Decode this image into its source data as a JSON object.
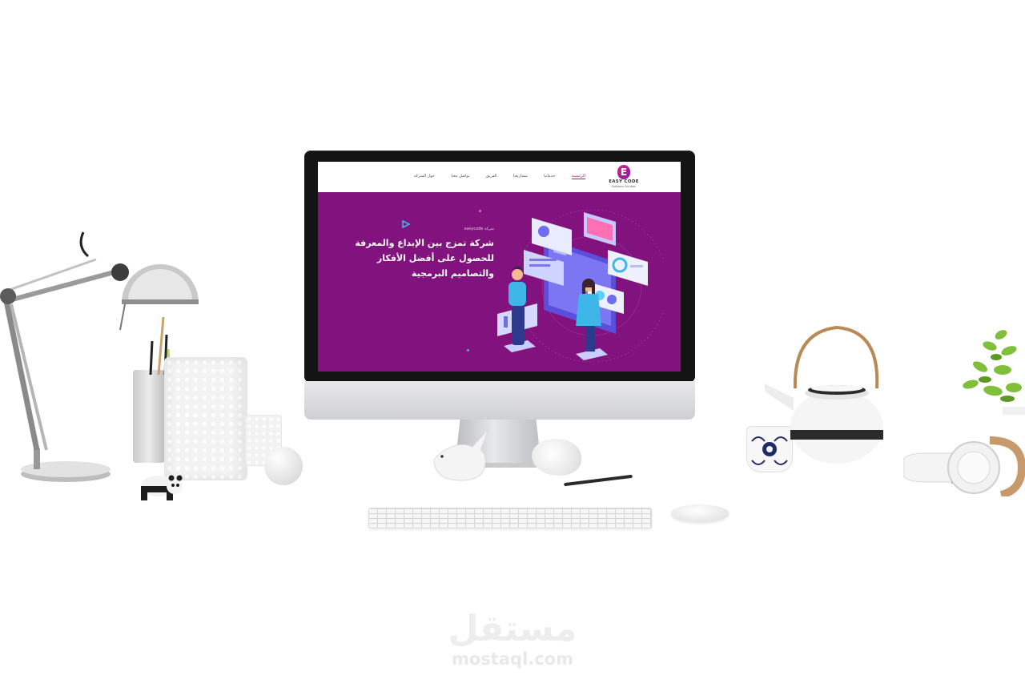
{
  "site": {
    "logo": {
      "mark": "E",
      "title": "EASY CODE",
      "subtitle": "Software Solution"
    },
    "nav": [
      {
        "label": "الرئيسية",
        "active": true
      },
      {
        "label": "خدماتنا",
        "active": false
      },
      {
        "label": "مشاريعنا",
        "active": false
      },
      {
        "label": "الفريق",
        "active": false
      },
      {
        "label": "تواصل معنا",
        "active": false
      },
      {
        "label": "حول الشركة",
        "active": false
      }
    ],
    "hero": {
      "label": "easycode شركة",
      "title_lines": [
        "شركة تمزج بين الإبداع والمعرفة",
        "للحصول على أفضل الأفكار",
        "والتصاميم البرمجية"
      ]
    },
    "colors": {
      "hero_background": "#82127d",
      "accent": "#b01e6e",
      "illustration": "#6f6cf0"
    }
  },
  "watermark": {
    "logo_text": "مستقل",
    "url": "mostaql.com"
  }
}
